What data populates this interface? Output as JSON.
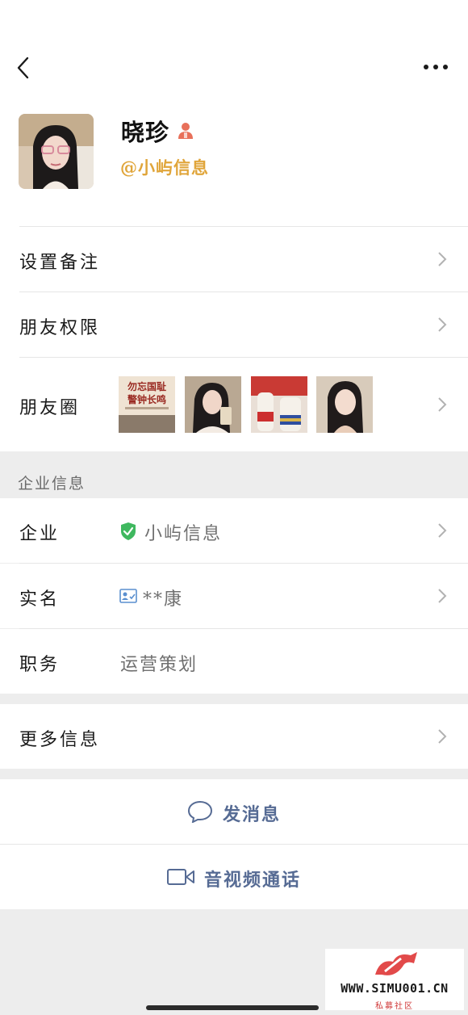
{
  "profile": {
    "name": "晓珍",
    "org_tag": "@小屿信息"
  },
  "rows": {
    "remark": "设置备注",
    "permissions": "朋友权限",
    "moments": "朋友圈"
  },
  "moments_thumbs": [
    {
      "title_line1": "勿忘国耻",
      "title_line2": "警钟长鸣"
    }
  ],
  "enterprise": {
    "section_label": "企业信息",
    "company_label": "企业",
    "company_value": "小屿信息",
    "realname_label": "实名",
    "realname_value": "**康",
    "job_label": "职务",
    "job_value": "运营策划"
  },
  "more_info": "更多信息",
  "actions": {
    "message": "发消息",
    "call": "音视频通话"
  },
  "watermark": {
    "site": "WWW.SIMU001.CN",
    "sub": "私募社区"
  },
  "colors": {
    "accent_org": "#e0a53a",
    "action_blue": "#566b94",
    "verified_green": "#3fb85f"
  }
}
